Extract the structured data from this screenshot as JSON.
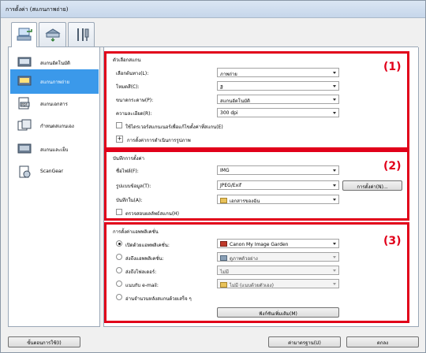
{
  "window": {
    "title": "การตั้งค่า (สแกนภาพถ่าย)"
  },
  "tabs": [
    {
      "icon": "scan-from-computer-icon"
    },
    {
      "icon": "scan-from-operation-panel-icon"
    },
    {
      "icon": "general-settings-icon"
    }
  ],
  "sidebar": {
    "items": [
      {
        "label": "สแกนอัตโนมัติ",
        "icon": "auto-scan-icon"
      },
      {
        "label": "สแกนภาพถ่าย",
        "icon": "photo-scan-icon",
        "selected": true
      },
      {
        "label": "สแกนเอกสาร",
        "icon": "document-scan-icon"
      },
      {
        "label": "กำหนดสแกนเอง",
        "icon": "custom-scan-icon"
      },
      {
        "label": "สแกนและเย็บ",
        "icon": "scan-and-stitch-icon"
      },
      {
        "label": "ScanGear",
        "icon": "scangear-icon"
      }
    ]
  },
  "scan_options": {
    "header": "ตัวเลือกสแกน",
    "number": "(1)",
    "source_label": "เลือกต้นทาง(L):",
    "source_value": "ภาพถ่าย",
    "color_label": "โหมดสี(C):",
    "color_value": "สี",
    "paper_label": "ขนาดกระดาษ(P):",
    "paper_value": "สแกนอัตโนมัติ",
    "resolution_label": "ความละเอียด(R):",
    "resolution_value": "300 dpi",
    "driver_checkbox": "ใช้ไดรเวอร์สแกนเนอร์เพื่อแก้ไขตั้งค่าที่สแกน(E)",
    "image_processing_label": "การตั้งค่าการดำเนินการรูปภาพ"
  },
  "save_settings": {
    "header": "บันทึกการตั้งค่า",
    "number": "(2)",
    "filename_label": "ชื่อไฟล์(F):",
    "filename_value": "IMG",
    "format_label": "รูปแบบข้อมูล(T):",
    "format_value": "JPEG/Exif",
    "format_settings_button": "การตั้งค่า(N)...",
    "save_in_label": "บันทึกใน(A):",
    "save_in_value": "เอกสารของฉัน",
    "check_result_checkbox": "ตรวจสอบผลลัพธ์สแกน(H)"
  },
  "app_settings": {
    "header": "การตั้งค่าแอพพลิเคชั่น",
    "number": "(3)",
    "open_app_label": "เปิดด้วยแอพพลิเคชั่น:",
    "open_app_value": "Canon My Image Garden",
    "send_app_label": "ส่งถึงแอพพลิเคชั่น:",
    "send_app_value": "ดูภาพตัวอย่าง",
    "send_folder_label": "ส่งถึงโฟลเดอร์:",
    "send_folder_value": "ไม่มี",
    "email_label": "แนบกับ e-mail:",
    "email_value": "ไม่มี (แนบด้วยตัวเอง)",
    "ocr_label": "อ่านจำนวนหลังสแกนด้วยเสร็จ ๆ",
    "more_functions_button": "ฟังก์ชันเพิ่มเติม(M)"
  },
  "footer": {
    "instructions_button": "ขั้นตอนการใช้(I)",
    "defaults_button": "ค่ามาตรฐาน(U)",
    "ok_button": "ตกลง"
  },
  "colors": {
    "highlight": "#e1001a",
    "selected": "#3b99ea"
  }
}
